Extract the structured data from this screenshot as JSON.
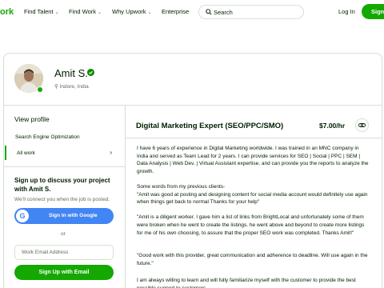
{
  "header": {
    "logo_text": "ork",
    "nav": [
      {
        "label": "Find Talent"
      },
      {
        "label": "Find Work"
      },
      {
        "label": "Why Upwork"
      },
      {
        "label": "Enterprise"
      }
    ],
    "search_label": "Search",
    "login_label": "Log In",
    "signup_label": "Sign"
  },
  "profile": {
    "name": "Amit S.",
    "location": "Indore, India"
  },
  "sidebar": {
    "view_profile": "View profile",
    "items": [
      {
        "label": "Search Engine Optimization"
      },
      {
        "label": "All work"
      }
    ],
    "cta_title": "Sign up to discuss your project with Amit S.",
    "cta_subtitle": "We’ll connect you when the job is posted.",
    "google_label": "Sign In with Google",
    "or_label": "or",
    "email_placeholder": "Work Email Address",
    "email_button": "Sign Up with Email"
  },
  "job": {
    "title": "Digital Marketing Expert (SEO/PPC/SMO)",
    "rate": "$7.00/hr",
    "paragraphs": [
      "I have 6 years of experience in Digital Marketing worldwide. I was trained in an MNC company in India and served as Team Lead for 2 years. I can provide services for SEO | Social | PPC | SEM | Data Analysis | Web Dev. | Virtual Assistant expertise, and can provide you the reports to analyze the growth.",
      "Some words from my previous clients-\n\"Amit was good at posting and designing content for social media account would definitely use again when things get back to normal Thanks for your help\"",
      "\"Amit is a diligent worker. I gave him a list of links from BrightLocal and unfortunately some of them were broken when he went to create the listings. he went above and beyond to create more listings for me of his own choosing, to assure that the proper SEO work was completed. Thanks Amit!\"",
      "\"Good work with this provider, great communication and adherence to deadline. Will use again in the future.\"",
      "I am always willing to learn and will fully familiarize myself with the customer to provide the best possible support to customers."
    ]
  },
  "colors": {
    "brand_green": "#14a800",
    "google_blue": "#4285f4",
    "text": "#001e00",
    "muted": "#5e6d55",
    "border": "#d5e0d5"
  }
}
